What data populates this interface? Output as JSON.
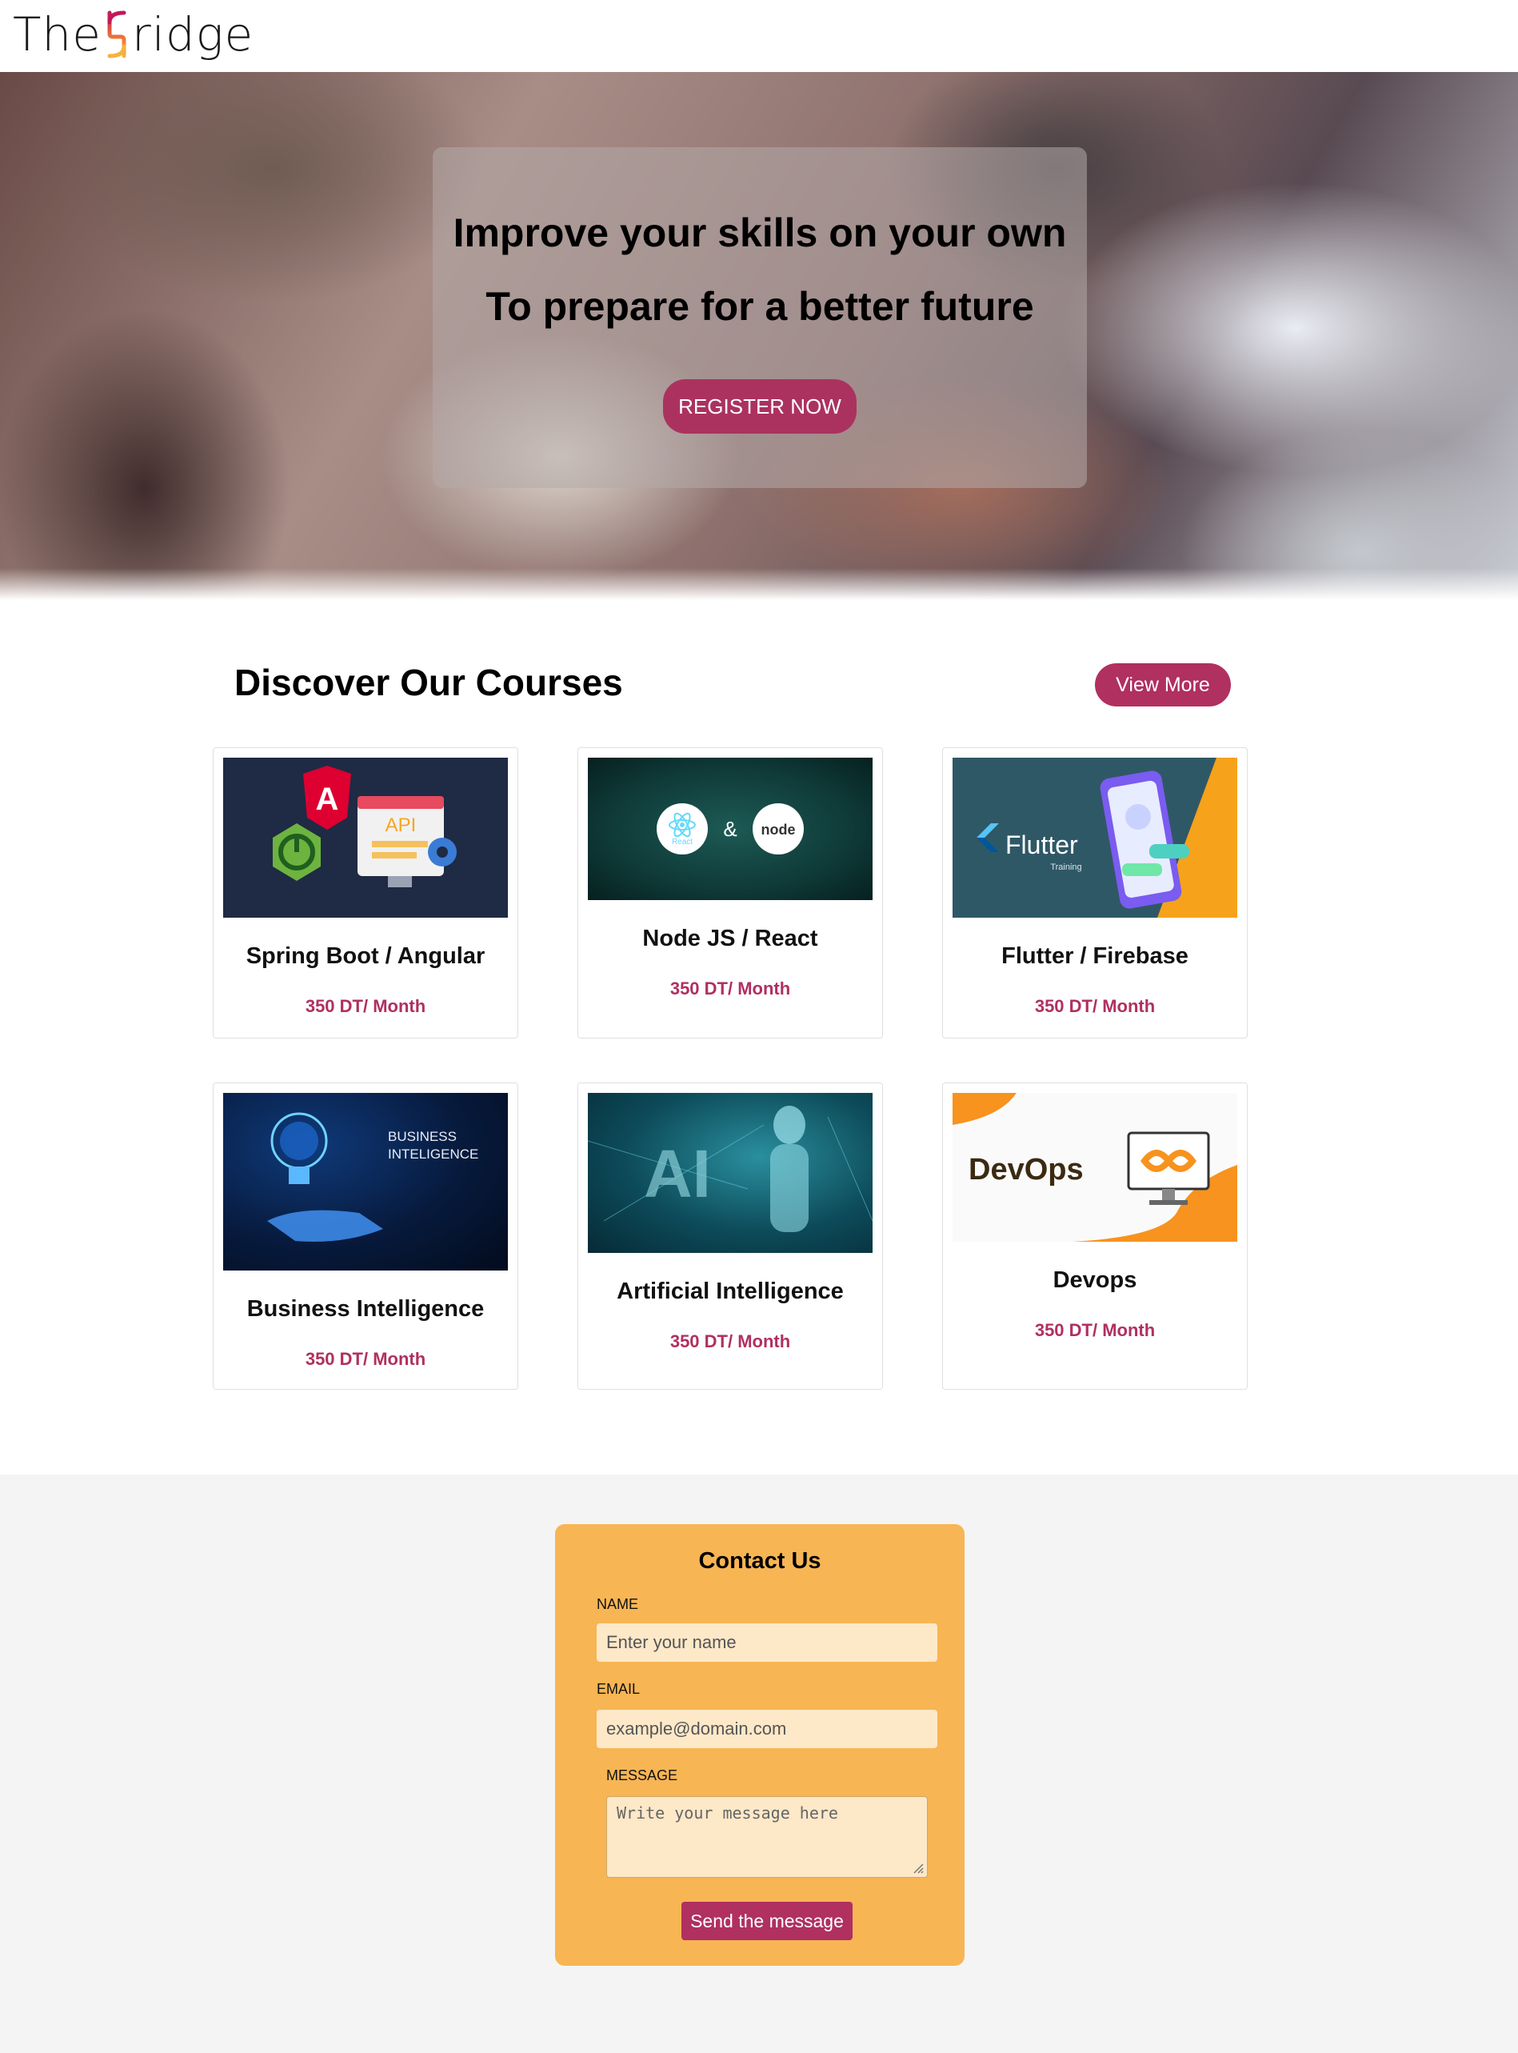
{
  "header": {
    "logo_prefix": "The ",
    "logo_suffix": "ridge",
    "logo_letter": "B"
  },
  "hero": {
    "line1": "Improve your skills on your own",
    "line2": "To prepare for a better future",
    "register_label": "REGISTER NOW"
  },
  "courses": {
    "title": "Discover Our Courses",
    "view_more_label": "View More",
    "items": [
      {
        "title": "Spring Boot / Angular",
        "price": "350 DT/ Month",
        "image": "spring-angular-image",
        "image_text": "API"
      },
      {
        "title": "Node JS / React",
        "price": "350 DT/ Month",
        "image": "node-react-image",
        "image_text": "&",
        "react_text": "React",
        "node_text": "node"
      },
      {
        "title": "Flutter / Firebase",
        "price": "350 DT/ Month",
        "image": "flutter-image",
        "image_text": "Flutter",
        "image_subtext": "Training"
      },
      {
        "title": "Business Intelligence",
        "price": "350 DT/ Month",
        "image": "bi-image",
        "image_text": "BUSINESS",
        "image_subtext": "INTELIGENCE"
      },
      {
        "title": "Artificial Intelligence",
        "price": "350 DT/ Month",
        "image": "ai-image",
        "image_text": "AI"
      },
      {
        "title": "Devops",
        "price": "350 DT/ Month",
        "image": "devops-image",
        "image_text": "DevOps"
      }
    ]
  },
  "contact": {
    "title": "Contact Us",
    "name_label": "NAME",
    "name_placeholder": "Enter your name",
    "email_label": "EMAIL",
    "email_placeholder": "example@domain.com",
    "message_label": "MESSAGE",
    "message_placeholder": "Write your message here",
    "send_label": "Send the message"
  },
  "colors": {
    "accent": "#b03060",
    "contact_bg": "#f7b554",
    "input_bg": "#fde8c8",
    "section_bg": "#f4f4f4"
  }
}
